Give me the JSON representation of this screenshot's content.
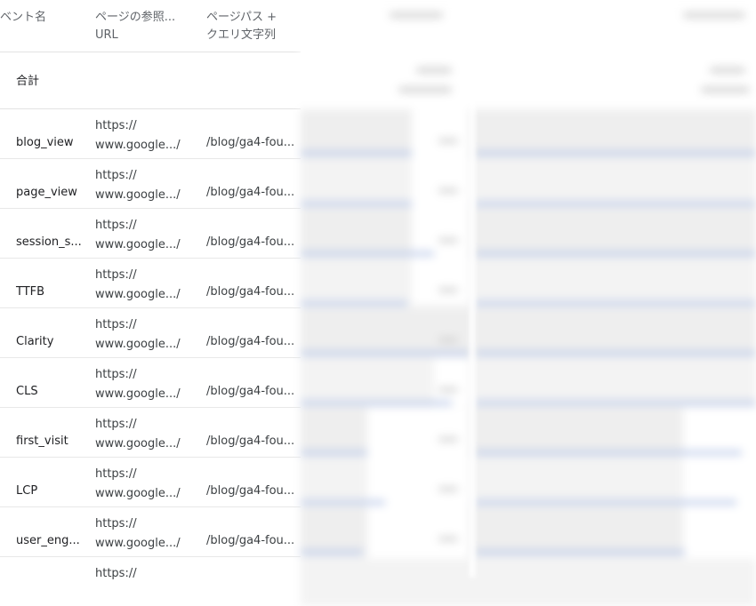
{
  "header": {
    "col1": "ベント名",
    "col2": "ページの参照...\nURL",
    "col3": "ページパス +\nクエリ文字列"
  },
  "total": {
    "label": "合計"
  },
  "rows": [
    {
      "event": "blog_view",
      "url": "https://\nwww.google.../",
      "path": "/blog/ga4-fou..."
    },
    {
      "event": "page_view",
      "url": "https://\nwww.google.../",
      "path": "/blog/ga4-fou..."
    },
    {
      "event": "session_s...",
      "url": "https://\nwww.google.../",
      "path": "/blog/ga4-fou..."
    },
    {
      "event": "TTFB",
      "url": "https://\nwww.google.../",
      "path": "/blog/ga4-fou..."
    },
    {
      "event": "Clarity",
      "url": "https://\nwww.google.../",
      "path": "/blog/ga4-fou..."
    },
    {
      "event": "CLS",
      "url": "https://\nwww.google.../",
      "path": "/blog/ga4-fou..."
    },
    {
      "event": "first_visit",
      "url": "https://\nwww.google.../",
      "path": "/blog/ga4-fou..."
    },
    {
      "event": "LCP",
      "url": "https://\nwww.google.../",
      "path": "/blog/ga4-fou..."
    },
    {
      "event": "user_eng...",
      "url": "https://\nwww.google.../",
      "path": "/blog/ga4-fou..."
    },
    {
      "event": "",
      "url": "https://",
      "path": ""
    }
  ],
  "colors": {
    "bar": "#bdcbe9",
    "border": "#e3e3e3",
    "header_text": "#5f6368"
  }
}
